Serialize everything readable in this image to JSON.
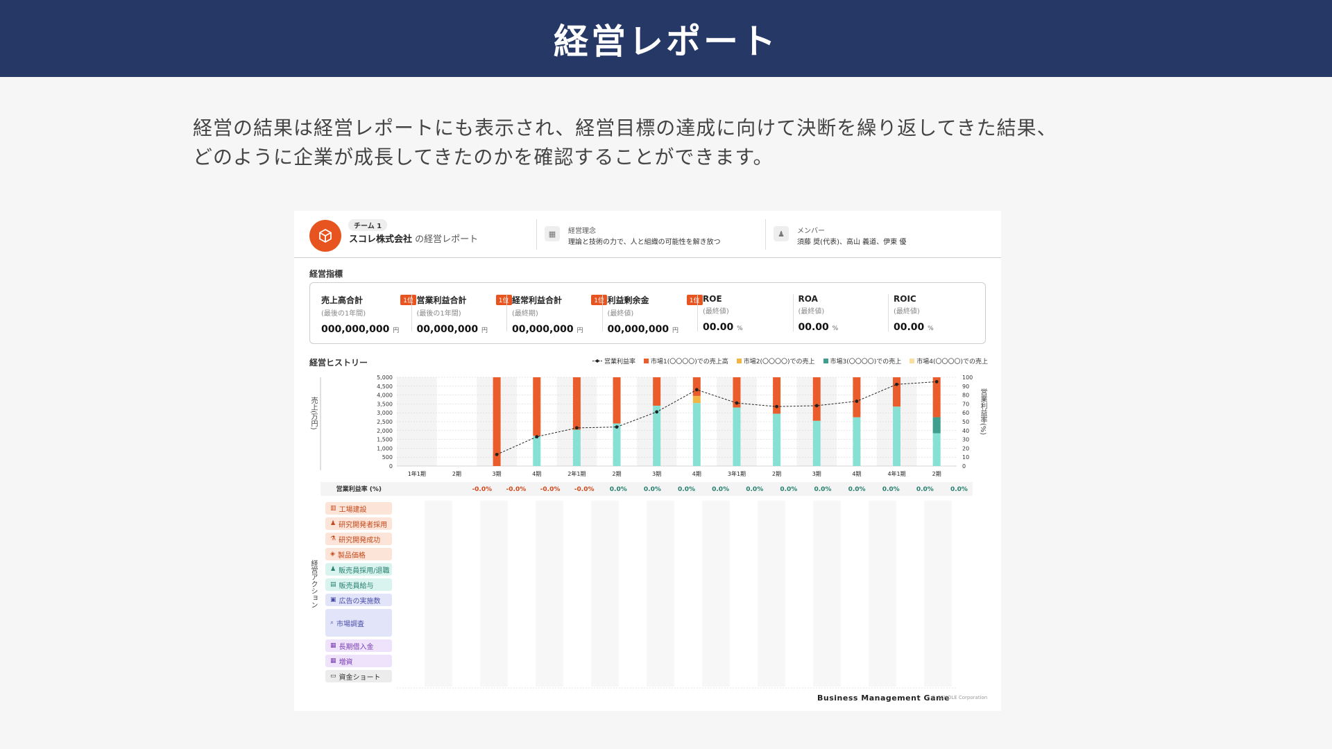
{
  "page": {
    "title": "経営レポート",
    "lead_line1": "経営の結果は経営レポートにも表示され、経営目標の達成に向けて決断を繰り返してきた結果、",
    "lead_line2": "どのように企業が成長してきたのかを確認することができます。"
  },
  "report": {
    "team_badge": "チーム 1",
    "company_name": "スコレ株式会社",
    "company_suffix": "の経営レポート",
    "philosophy_label": "経営理念",
    "philosophy_value": "理論と技術の力で、人と組織の可能性を解き放つ",
    "members_label": "メンバー",
    "members_value": "須藤 奨(代表)、高山 義道、伊東 優"
  },
  "kpi_section": {
    "title": "経営指標",
    "items": [
      {
        "title": "売上高合計",
        "sub": "(最後の1年間)",
        "value": "000,000,000",
        "unit": "円",
        "rank": "1位"
      },
      {
        "title": "営業利益合計",
        "sub": "(最後の1年間)",
        "value": "00,000,000",
        "unit": "円",
        "rank": "1位"
      },
      {
        "title": "経常利益合計",
        "sub": "(最終期)",
        "value": "00,000,000",
        "unit": "円",
        "rank": "1位"
      },
      {
        "title": "利益剰余金",
        "sub": "(最終値)",
        "value": "00,000,000",
        "unit": "円",
        "rank": "1位"
      },
      {
        "title": "ROE",
        "sub": "(最終値)",
        "value": "00.00",
        "unit": "%"
      },
      {
        "title": "ROA",
        "sub": "(最終値)",
        "value": "00.00",
        "unit": "%"
      },
      {
        "title": "ROIC",
        "sub": "(最終値)",
        "value": "00.00",
        "unit": "%"
      }
    ]
  },
  "history_title": "経営ヒストリー",
  "legend": {
    "line": "営業利益率",
    "m1": "市場1(〇〇〇〇)での売上高",
    "m2": "市場2(〇〇〇〇)での売上",
    "m3": "市場3(〇〇〇〇)での売上",
    "m4": "市場4(〇〇〇〇)での売上"
  },
  "colors": {
    "m1": "#ea5c2b",
    "m2": "#f2b544",
    "m3": "#3f9e8d",
    "m4": "#f8df9c",
    "teal": "#86e0d4",
    "header": "#263865"
  },
  "chart_data": {
    "type": "bar",
    "categories": [
      "1年1期",
      "2期",
      "3期",
      "4期",
      "2年1期",
      "2期",
      "3期",
      "4期",
      "3年1期",
      "2期",
      "3期",
      "4期",
      "4年1期",
      "2期"
    ],
    "ylabel": "売上(万円)",
    "y2label": "営業利益率(%)",
    "ylim": [
      0,
      5000
    ],
    "y2lim": [
      0,
      100
    ],
    "yticks": [
      "5,000",
      "4,500",
      "4,000",
      "3,500",
      "3,000",
      "2,500",
      "2,000",
      "1,500",
      "1,000",
      "500",
      "0"
    ],
    "y2ticks": [
      "100",
      "90",
      "80",
      "70",
      "60",
      "50",
      "40",
      "30",
      "20",
      "10",
      "0"
    ],
    "series": [
      {
        "name": "市場1(〇〇〇〇)での売上高",
        "values": [
          0,
          0,
          5000,
          3300,
          2950,
          2600,
          1600,
          1050,
          1700,
          2050,
          2450,
          2250,
          1650,
          2250
        ]
      },
      {
        "name": "市場2(〇〇〇〇)での売上",
        "values": [
          0,
          0,
          0,
          0,
          0,
          0,
          0,
          400,
          0,
          0,
          0,
          0,
          0,
          0
        ]
      },
      {
        "name": "市場3(〇〇〇〇)での売上",
        "values": [
          0,
          0,
          0,
          1700,
          2050,
          2400,
          3400,
          3550,
          3300,
          2950,
          2550,
          2750,
          3350,
          2750
        ]
      },
      {
        "name": "市場4(〇〇〇〇)での売上",
        "values": [
          0,
          0,
          0,
          0,
          0,
          0,
          0,
          0,
          0,
          0,
          0,
          0,
          0,
          0
        ]
      }
    ],
    "line": {
      "name": "営業利益率",
      "values": [
        null,
        null,
        13,
        33,
        43,
        44,
        61,
        86,
        71,
        67,
        68,
        73,
        92,
        95
      ]
    },
    "rate_row_label": "営業利益率 (%)",
    "rate_values": [
      "",
      "",
      "-0.0%",
      "-0.0%",
      "-0.0%",
      "-0.0%",
      "0.0%",
      "0.0%",
      "0.0%",
      "0.0%",
      "0.0%",
      "0.0%",
      "0.0%",
      "0.0%",
      "0.0%",
      "0.0%",
      "0.0%"
    ]
  },
  "actions": {
    "label": "経営アクション",
    "items": [
      {
        "label": "工場建設",
        "icon": "factory-icon"
      },
      {
        "label": "研究開発者採用",
        "icon": "person-icon"
      },
      {
        "label": "研究開発成功",
        "icon": "flask-icon"
      },
      {
        "label": "製品価格",
        "icon": "price-tag-icon"
      },
      {
        "label": "販売員採用/退職",
        "icon": "person-icon"
      },
      {
        "label": "販売員給与",
        "icon": "wallet-icon"
      },
      {
        "label": "広告の実施数",
        "icon": "megaphone-icon"
      },
      {
        "label": "市場調査",
        "icon": "search-icon"
      },
      {
        "label": "長期借入金",
        "icon": "bank-icon"
      },
      {
        "label": "増資",
        "icon": "bank-icon"
      },
      {
        "label": "資金ショート",
        "icon": "cash-icon"
      }
    ]
  },
  "footer": {
    "brand": "Business Management Game",
    "copyright": "© SCHOLE Corporation"
  }
}
